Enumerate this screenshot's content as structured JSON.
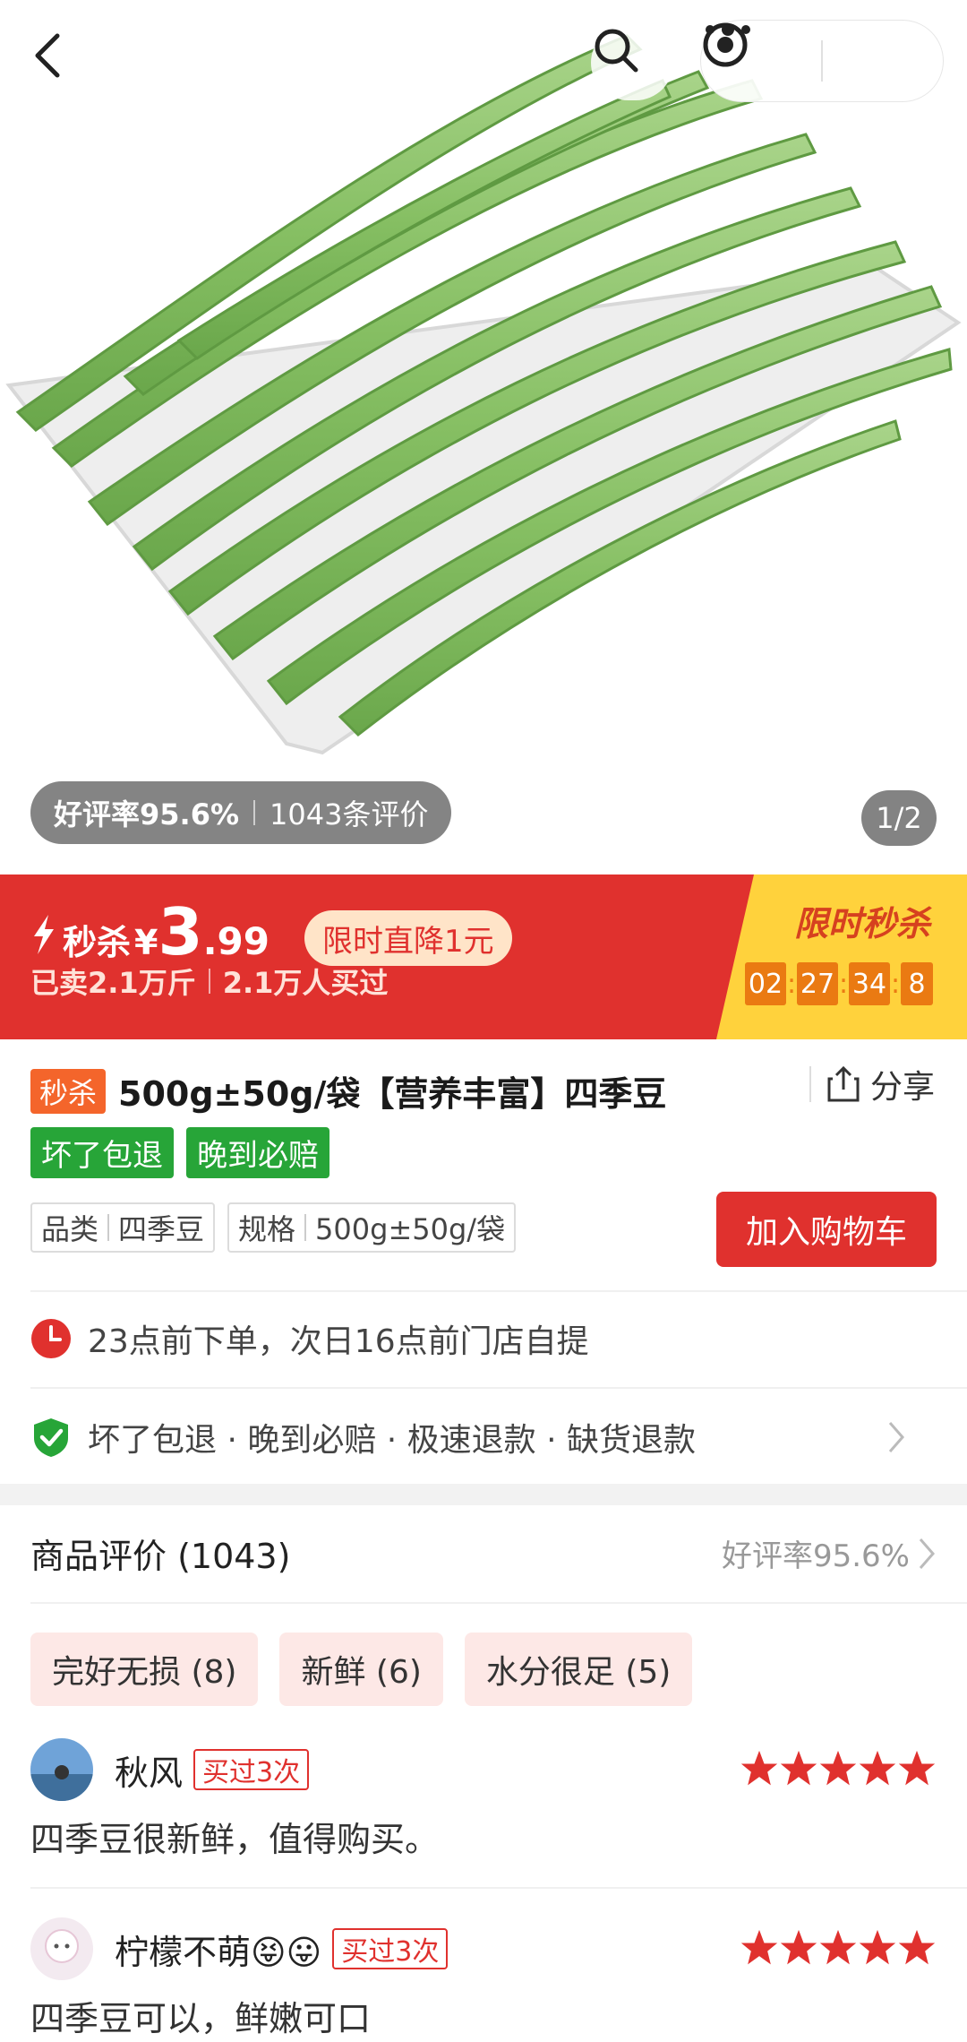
{
  "nav": {
    "back_icon": "chevron-left-icon",
    "search_icon": "search-icon",
    "more_icon": "more-dots-icon",
    "target_icon": "target-icon"
  },
  "hero": {
    "rating_label": "好评率95.6%",
    "reviews_count": "1043条评价",
    "page_indicator": "1/2"
  },
  "flash_sale": {
    "label": "秒杀",
    "currency": "¥",
    "price_int": "3",
    "price_dec": ".99",
    "drop_tag": "限时直降1元",
    "sold": "已卖2.1万斤",
    "buyers": "2.1万人买过",
    "limited_title": "限时秒杀",
    "countdown": [
      "02",
      "27",
      "34",
      "8"
    ],
    "accent": "#e0312e",
    "panel_color": "#ffd23c"
  },
  "product": {
    "tag": "秒杀",
    "title": "500g±50g/袋【营养丰富】四季豆",
    "share": "分享",
    "guarantees": [
      "坏了包退",
      "晚到必赔"
    ],
    "spec_category_label": "品类",
    "spec_category_value": "四季豆",
    "spec_size_label": "规格",
    "spec_size_value": "500g±50g/袋",
    "add_to_cart": "加入购物车"
  },
  "delivery": {
    "text": "23点前下单，次日16点前门店自提"
  },
  "service": {
    "text": "坏了包退 · 晚到必赔 · 极速退款 · 缺货退款"
  },
  "reviews": {
    "title": "商品评价 (1043)",
    "rate": "好评率95.6%",
    "keywords": [
      "完好无损 (8)",
      "新鲜 (6)",
      "水分很足 (5)"
    ],
    "items": [
      {
        "name": "秋风",
        "badge": "买过3次",
        "stars": 5,
        "text": "四季豆很新鲜，值得购买。"
      },
      {
        "name": "柠檬不萌😝😛",
        "badge": "买过3次",
        "stars": 5,
        "text": "四季豆可以，鲜嫩可口"
      }
    ]
  }
}
